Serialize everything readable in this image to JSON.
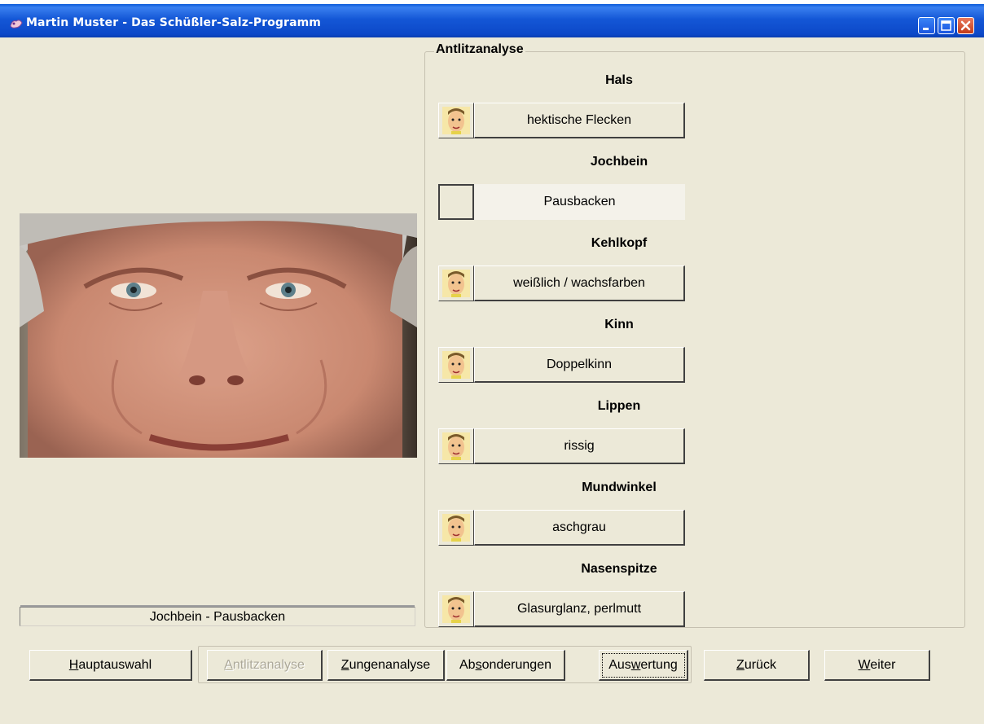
{
  "window": {
    "title": "Martin Muster - Das Schüßler-Salz-Programm",
    "controls": [
      "minimize-icon",
      "maximize-icon",
      "close-icon"
    ]
  },
  "photo": {
    "caption": "Jochbein - Pausbacken"
  },
  "analysis": {
    "title": "Antlitzanalyse",
    "items": [
      {
        "category": "Hals",
        "label": "hektische Flecken",
        "has_face": true
      },
      {
        "category": "Jochbein",
        "label": "Pausbacken",
        "has_face": false,
        "selected": true
      },
      {
        "category": "Kehlkopf",
        "label": "weißlich / wachsfarben",
        "has_face": true
      },
      {
        "category": "Kinn",
        "label": "Doppelkinn",
        "has_face": true
      },
      {
        "category": "Lippen",
        "label": "rissig",
        "has_face": true
      },
      {
        "category": "Mundwinkel",
        "label": "aschgrau",
        "has_face": true
      },
      {
        "category": "Nasenspitze",
        "label": "Glasurglanz, perlmutt",
        "has_face": true
      }
    ]
  },
  "nav": {
    "hauptauswahl": {
      "pre": "",
      "key": "H",
      "post": "auptauswahl"
    },
    "antlitz": {
      "pre": "",
      "key": "A",
      "post": "ntlitzanalyse"
    },
    "zunge": {
      "pre": "",
      "key": "Z",
      "post": "ungenanalyse"
    },
    "absond": {
      "pre": "Ab",
      "key": "s",
      "post": "onderungen"
    },
    "ausw": {
      "pre": "Aus",
      "key": "w",
      "post": "ertung"
    },
    "zurueck": {
      "pre": "",
      "key": "Z",
      "post": "urück"
    },
    "weiter": {
      "pre": "",
      "key": "W",
      "post": "eiter"
    }
  },
  "colors": {
    "titlebar": "#0a5ad8",
    "background": "#ece9d8"
  }
}
